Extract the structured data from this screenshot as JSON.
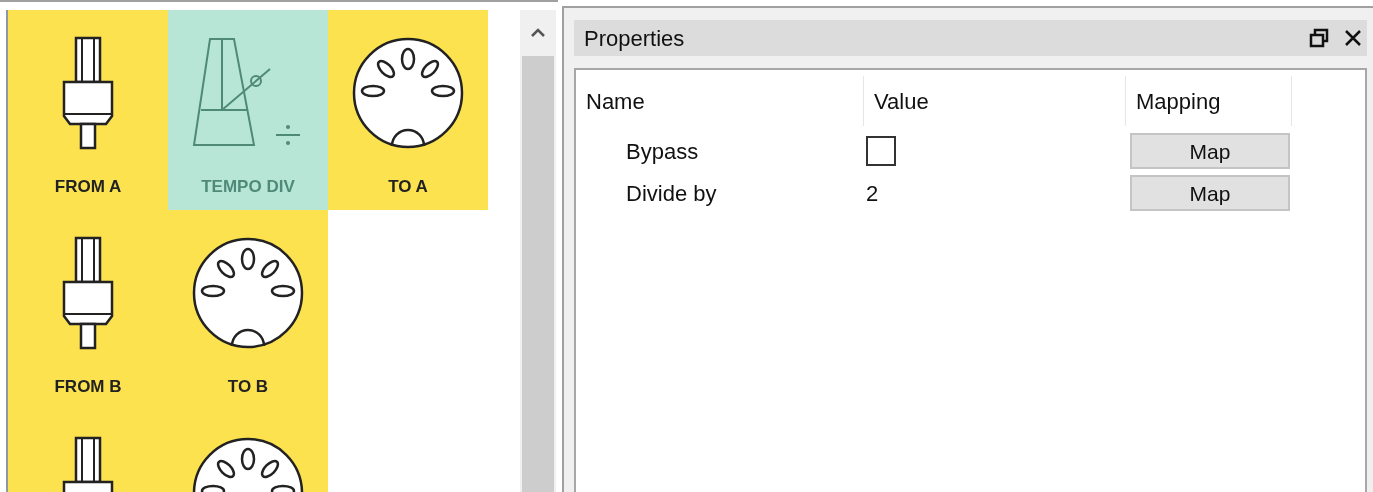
{
  "palette": {
    "rows": [
      {
        "tiles": [
          {
            "kind": "jack",
            "label": "FROM A",
            "color": "#fde24f"
          },
          {
            "kind": "metronome",
            "label": "TEMPO DIV",
            "color": "#b8e6d6"
          },
          {
            "kind": "midi",
            "label": "TO A",
            "color": "#fde24f"
          }
        ]
      },
      {
        "tiles": [
          {
            "kind": "jack",
            "label": "FROM B",
            "color": "#fde24f"
          },
          {
            "kind": "midi",
            "label": "TO B",
            "color": "#fde24f"
          }
        ]
      },
      {
        "tiles": [
          {
            "kind": "jack",
            "color": "#fde24f"
          },
          {
            "kind": "midi",
            "color": "#fde24f"
          }
        ]
      }
    ]
  },
  "properties": {
    "title": "Properties",
    "columns": [
      "Name",
      "Value",
      "Mapping"
    ],
    "rows": [
      {
        "name": "Bypass",
        "kind": "checkbox",
        "checked": false,
        "mapping": "Map"
      },
      {
        "name": "Divide by",
        "kind": "text",
        "value": "2",
        "mapping": "Map"
      }
    ]
  }
}
